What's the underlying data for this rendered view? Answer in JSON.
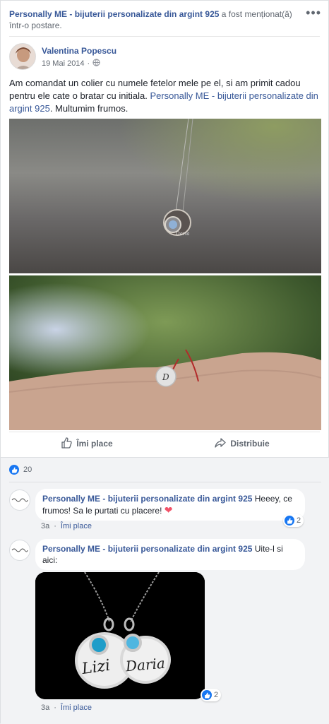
{
  "header": {
    "page_name": "Personally ME - bijuterii personalizate din argint 925",
    "mention_text": " a fost menționat(ă) într-o postare.",
    "more": "•••"
  },
  "post": {
    "author": "Valentina Popescu",
    "date": "19 Mai 2014",
    "dot": "·",
    "text_before": "Am comandat un colier cu numele fetelor mele pe el, si am primit cadou pentru ele cate o bratar cu initiala. ",
    "text_link": "Personally ME - bijuterii personalizate din argint 925",
    "text_after": ". Multumim frumos.",
    "photo_1_alt": "Necklace pendant photo",
    "photo_2_alt": "Bracelet photo",
    "like_label": "Îmi place",
    "share_label": "Distribuie",
    "reaction_count": "20"
  },
  "comments": [
    {
      "author": "Personally ME - bijuterii personalizate din argint 925",
      "text": " Heeey, ce frumos! Sa le purtati cu placere! ",
      "emoji": "❤",
      "age": "3a",
      "like": "Îmi place",
      "likes": "2"
    },
    {
      "author": "Personally ME - bijuterii personalizate din argint 925",
      "text": " Uite-l si aici:",
      "age": "3a",
      "like": "Îmi place",
      "likes": "2",
      "image_names": [
        "Lizi",
        "Daria"
      ]
    }
  ],
  "colors": {
    "link": "#385898",
    "secondary": "#606770",
    "like_blue": "#1877f2",
    "heart": "#f25268"
  }
}
